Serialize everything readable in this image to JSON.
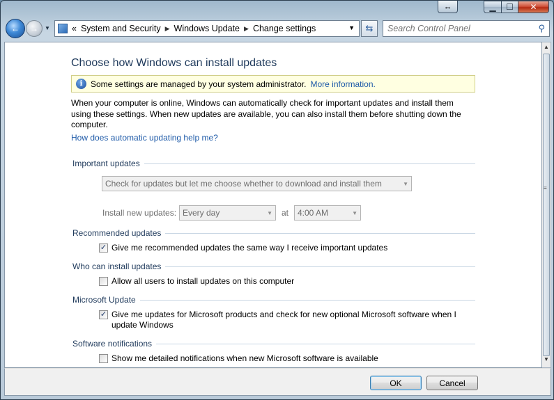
{
  "window": {
    "snap_icon": "resize-arrows-icon",
    "minimize_icon": "minimize-icon",
    "maximize_icon": "maximize-icon",
    "close_icon": "close-icon"
  },
  "nav": {
    "breadcrumb_prefix": "«",
    "breadcrumbs": [
      "System and Security",
      "Windows Update",
      "Change settings"
    ],
    "search_placeholder": "Search Control Panel"
  },
  "page": {
    "title": "Choose how Windows can install updates",
    "info_text": "Some settings are managed by your system administrator.",
    "info_link": "More information.",
    "description": "When your computer is online, Windows can automatically check for important updates and install them using these settings. When new updates are available, you can also install them before shutting down the computer.",
    "help_link": "How does automatic updating help me?"
  },
  "sections": {
    "important": {
      "title": "Important updates",
      "mode_value": "Check for updates but let me choose whether to download and install them",
      "install_label": "Install new updates:",
      "day_value": "Every day",
      "at_label": "at",
      "time_value": "4:00 AM"
    },
    "recommended": {
      "title": "Recommended updates",
      "checkbox_label": "Give me recommended updates the same way I receive important updates",
      "checked": true
    },
    "who": {
      "title": "Who can install updates",
      "checkbox_label": "Allow all users to install updates on this computer",
      "checked": false
    },
    "microsoft": {
      "title": "Microsoft Update",
      "checkbox_label": "Give me updates for Microsoft products and check for new optional Microsoft software when I update Windows",
      "checked": true
    },
    "notifications": {
      "title": "Software notifications",
      "checkbox_label": "Show me detailed notifications when new Microsoft software is available",
      "checked": false
    }
  },
  "footer": {
    "ok_label": "OK",
    "cancel_label": "Cancel"
  }
}
